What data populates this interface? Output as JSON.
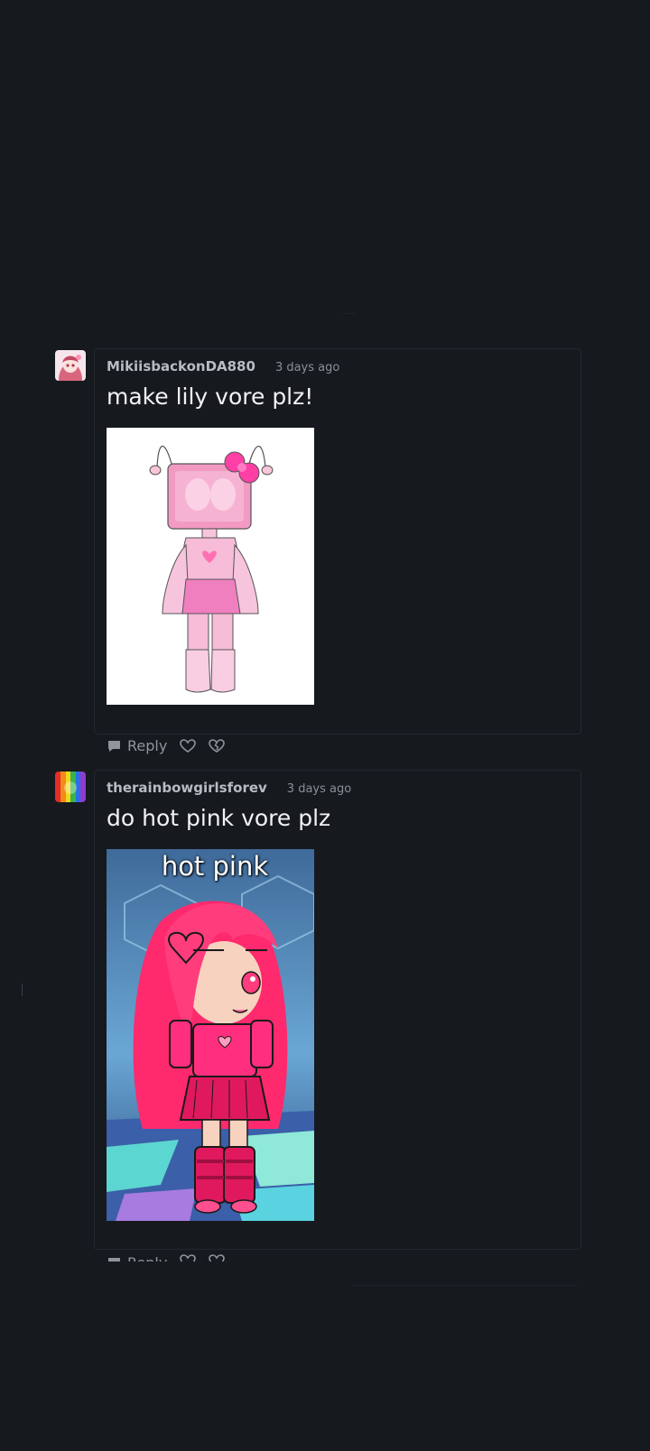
{
  "comments": [
    {
      "username": "MikiisbackonDA880",
      "time": "3 days ago",
      "text": "make lily vore plz!",
      "reply_label": "Reply",
      "image_caption": ""
    },
    {
      "username": "therainbowgirlsforev",
      "time": "3 days ago",
      "text": "do hot pink vore plz",
      "reply_label": "Reply",
      "image_caption": "hot pink"
    }
  ],
  "colors": {
    "background": "#16191e",
    "text": "#f1f2f4",
    "username": "#b7bcc4",
    "pink": "#ff2e7e"
  },
  "icons": [
    "reply-icon",
    "heart-icon",
    "heart-break-icon"
  ]
}
